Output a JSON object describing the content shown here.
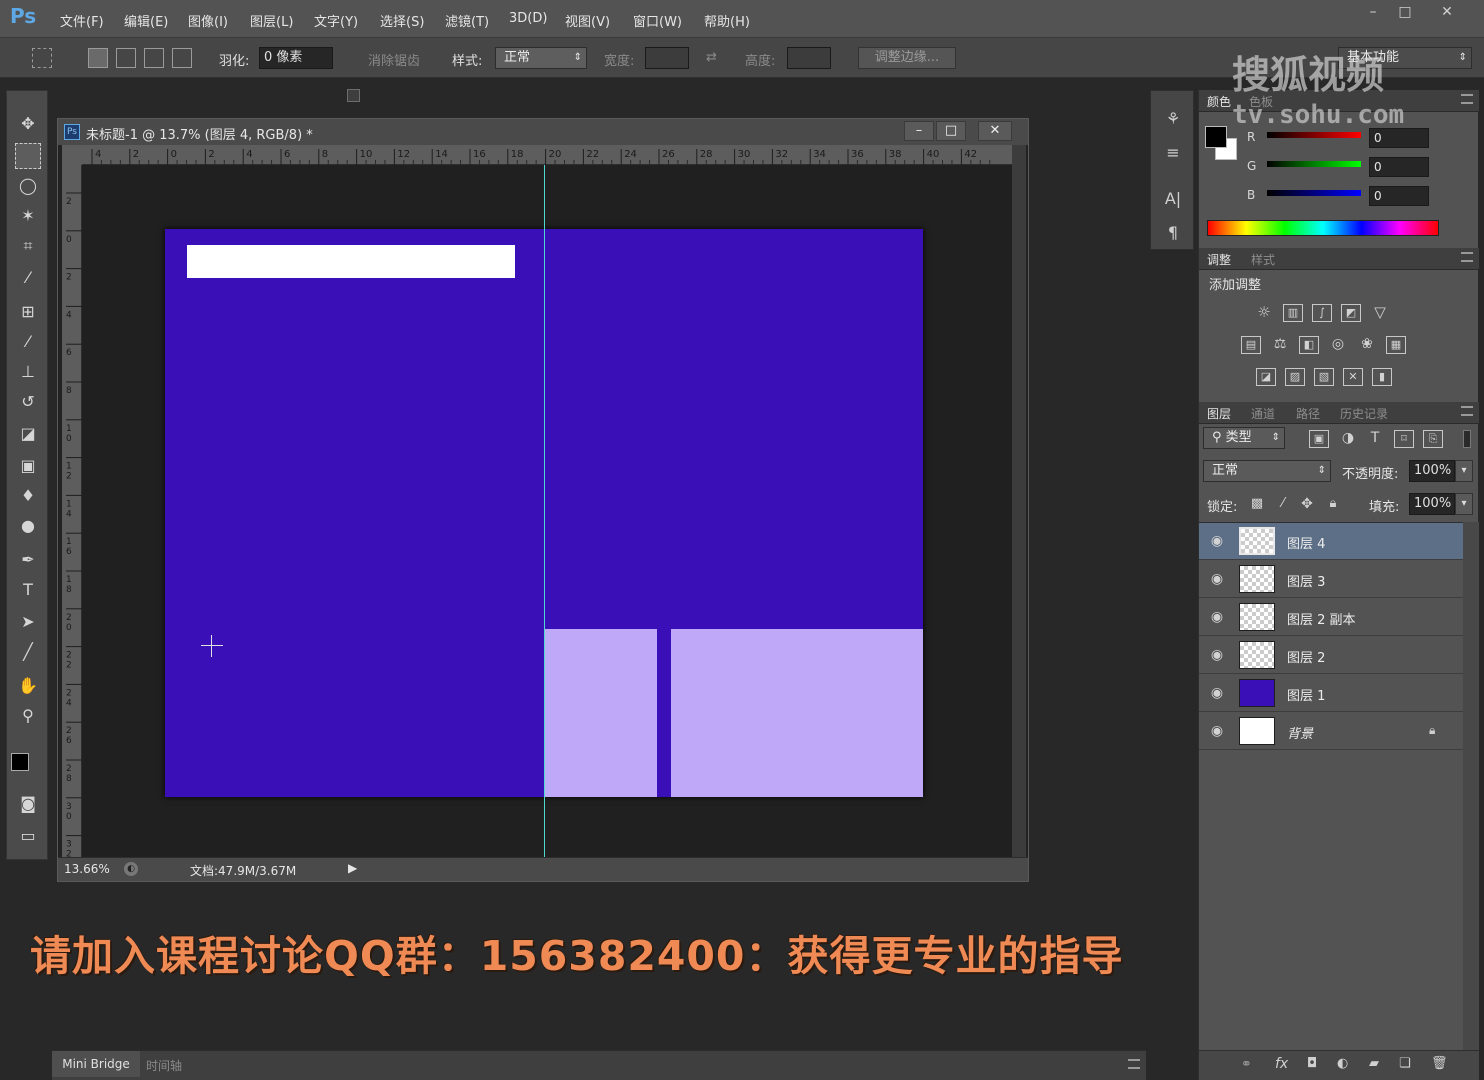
{
  "app": {
    "logo": "Ps",
    "menu": [
      "文件(F)",
      "编辑(E)",
      "图像(I)",
      "图层(L)",
      "文字(Y)",
      "选择(S)",
      "滤镜(T)",
      "3D(D)",
      "视图(V)",
      "窗口(W)",
      "帮助(H)"
    ],
    "window_controls": [
      "–",
      "□",
      "✕"
    ]
  },
  "options": {
    "feather_label": "羽化:",
    "feather_value": "0 像素",
    "antialias_label": "消除锯齿",
    "style_label": "样式:",
    "style_value": "正常",
    "width_label": "宽度:",
    "height_label": "高度:",
    "refine_edge": "调整边缘...",
    "workspace": "基本功能"
  },
  "document": {
    "title": "未标题-1 @ 13.7% (图层 4, RGB/8) *",
    "zoom": "13.66%",
    "doc_size": "文档:47.9M/3.67M",
    "ruler_top": [
      "4",
      "2",
      "0",
      "2",
      "4",
      "6",
      "8",
      "10",
      "12",
      "14",
      "16",
      "18",
      "20",
      "22",
      "24",
      "26",
      "28",
      "30",
      "32",
      "34",
      "36",
      "38",
      "40",
      "42"
    ],
    "ruler_left": [
      "2",
      "0",
      "2",
      "4",
      "6",
      "8",
      "10",
      "12",
      "14",
      "16",
      "18",
      "20",
      "22",
      "24",
      "26",
      "28",
      "30",
      "32"
    ],
    "canvas_colors": {
      "background": "#3a0fb8",
      "light": "#c0a8f8",
      "white_bar": "#ffffff",
      "guide": "#4fd8d0"
    }
  },
  "color_panel": {
    "tabs": [
      "颜色",
      "色板"
    ],
    "channels": [
      {
        "label": "R",
        "value": "0"
      },
      {
        "label": "G",
        "value": "0"
      },
      {
        "label": "B",
        "value": "0"
      }
    ]
  },
  "adjust_panel": {
    "tabs": [
      "调整",
      "样式"
    ],
    "heading": "添加调整"
  },
  "layers_panel": {
    "tabs": [
      "图层",
      "通道",
      "路径",
      "历史记录"
    ],
    "filter_label": "类型",
    "blend_mode": "正常",
    "opacity_label": "不透明度:",
    "opacity_value": "100%",
    "lock_label": "锁定:",
    "fill_label": "填充:",
    "fill_value": "100%",
    "layers": [
      {
        "name": "图层 4",
        "selected": true,
        "thumb": "checker"
      },
      {
        "name": "图层 3",
        "selected": false,
        "thumb": "checker"
      },
      {
        "name": "图层 2 副本",
        "selected": false,
        "thumb": "checker"
      },
      {
        "name": "图层 2",
        "selected": false,
        "thumb": "checker"
      },
      {
        "name": "图层 1",
        "selected": false,
        "thumb": "#3a0fb8"
      },
      {
        "name": "背景",
        "selected": false,
        "thumb": "#ffffff"
      }
    ]
  },
  "bottom": {
    "tabs": [
      "Mini Bridge",
      "时间轴"
    ]
  },
  "overlay": {
    "promo": "请加入课程讨论QQ群：156382400：获得更专业的指导",
    "watermark_cn": "搜狐视频",
    "watermark_url": "tv.sohu.com"
  }
}
